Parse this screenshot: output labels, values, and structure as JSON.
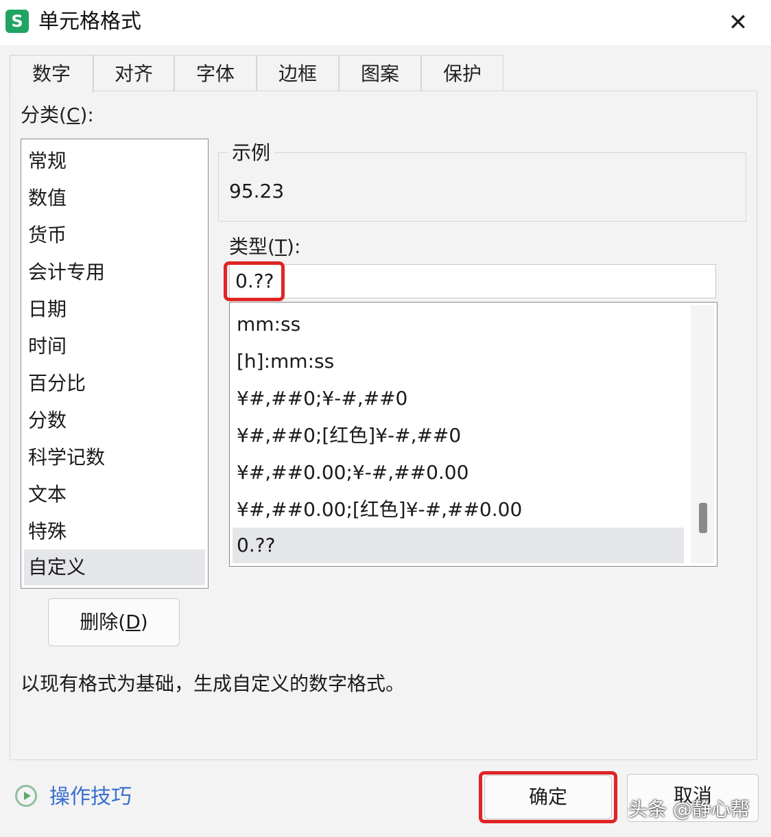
{
  "window": {
    "app_icon": "S",
    "title": "单元格格式",
    "close_glyph": "✕"
  },
  "tabs": [
    {
      "label": "数字",
      "active": true
    },
    {
      "label": "对齐",
      "active": false
    },
    {
      "label": "字体",
      "active": false
    },
    {
      "label": "边框",
      "active": false
    },
    {
      "label": "图案",
      "active": false
    },
    {
      "label": "保护",
      "active": false
    }
  ],
  "category": {
    "label_prefix": "分类(",
    "label_key": "C",
    "label_suffix": "):",
    "items": [
      "常规",
      "数值",
      "货币",
      "会计专用",
      "日期",
      "时间",
      "百分比",
      "分数",
      "科学记数",
      "文本",
      "特殊",
      "自定义"
    ],
    "selected": "自定义"
  },
  "sample": {
    "legend": "示例",
    "value": "95.23"
  },
  "type": {
    "label_prefix": "类型(",
    "label_key": "T",
    "label_suffix": "):",
    "value": "0.??",
    "formats": [
      "mm:ss",
      "[h]:mm:ss",
      "¥#,##0;¥-#,##0",
      "¥#,##0;[红色]¥-#,##0",
      "¥#,##0.00;¥-#,##0.00",
      "¥#,##0.00;[红色]¥-#,##0.00",
      "0.??"
    ],
    "selected": "0.??"
  },
  "delete_button": {
    "prefix": "删除(",
    "key": "D",
    "suffix": ")"
  },
  "hint": "以现有格式为基础，生成自定义的数字格式。",
  "tips": "操作技巧",
  "ok_label": "确定",
  "cancel_label": "取消",
  "watermark": "头条 @静心帮",
  "colors": {
    "highlight_box": "#e02424",
    "link": "#3a6fd0",
    "app_icon": "#1fa463"
  }
}
